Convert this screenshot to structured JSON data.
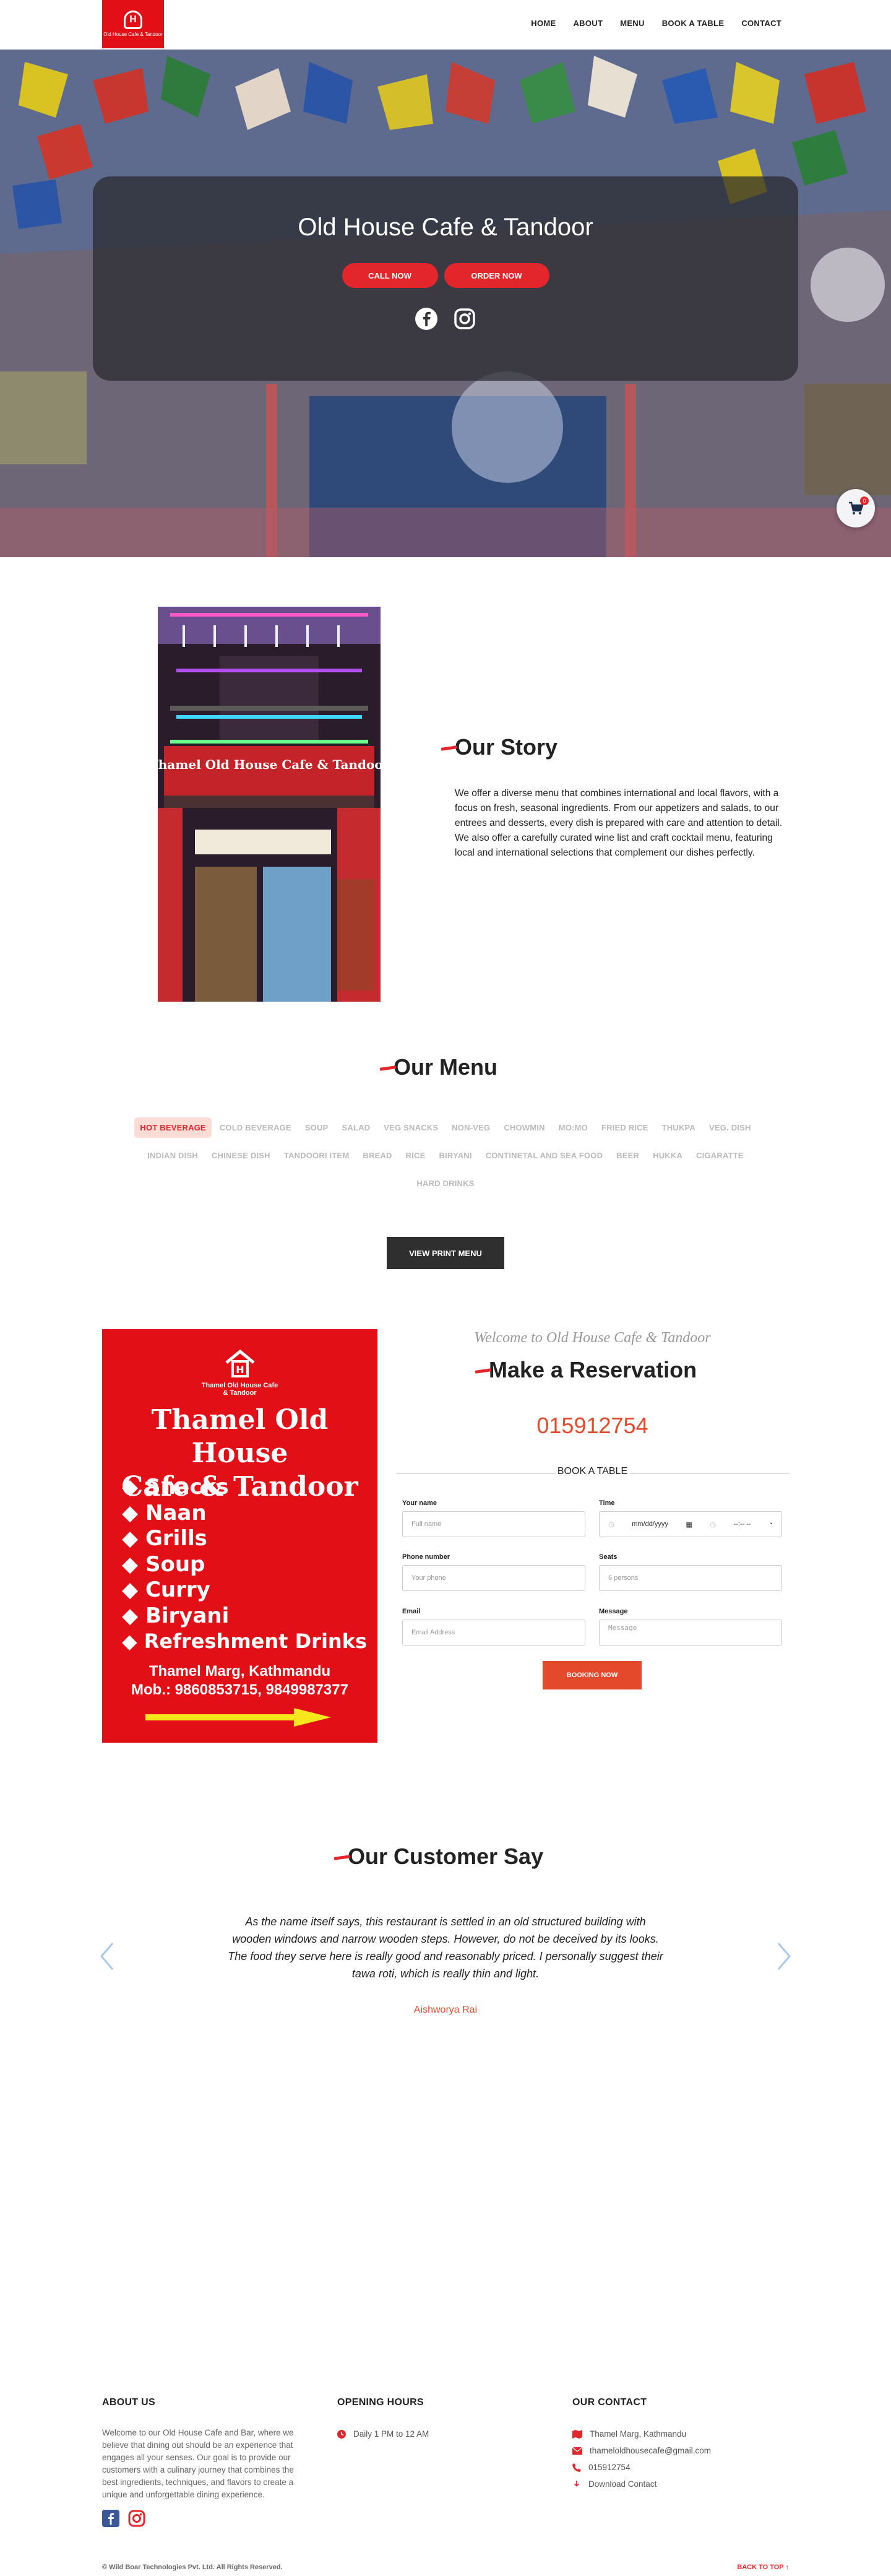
{
  "colors": {
    "brand_red": "#e3262b",
    "accent_orange": "#e5492c",
    "dark": "#2f2f2f"
  },
  "nav": {
    "logo_text": "Old House Cafe & Tandoor",
    "links": [
      "HOME",
      "ABOUT",
      "MENU",
      "BOOK A TABLE",
      "CONTACT"
    ]
  },
  "hero": {
    "title": "Old House Cafe & Tandoor",
    "call_label": "CALL NOW",
    "order_label": "ORDER NOW",
    "social_icons": [
      "facebook-icon",
      "instagram-icon"
    ],
    "cart_count": "0"
  },
  "story": {
    "heading": "Our Story",
    "sign_text": "Thamel Old House Cafe & Tandoor",
    "paragraph": "We offer a diverse menu that combines international and local flavors, with a focus on fresh, seasonal ingredients. From our appetizers and salads, to our entrees and desserts, every dish is prepared with care and attention to detail. We also offer a carefully curated wine list and craft cocktail menu, featuring local and international selections that complement our dishes perfectly."
  },
  "menu": {
    "heading": "Our Menu",
    "categories": [
      "HOT BEVERAGE",
      "COLD BEVERAGE",
      "SOUP",
      "SALAD",
      "VEG SNACKS",
      "NON-VEG",
      "CHOWMIN",
      "MO:MO",
      "FRIED RICE",
      "THUKPA",
      "VEG. DISH",
      "INDIAN DISH",
      "CHINESE DISH",
      "TANDOORI ITEM",
      "BREAD",
      "RICE",
      "BIRYANI",
      "CONTINETAL AND SEA FOOD",
      "BEER",
      "HUKKA",
      "CIGARATTE",
      "HARD DRINKS"
    ],
    "active_index": 0,
    "print_label": "VIEW PRINT MENU"
  },
  "poster": {
    "logo_line1": "Thamel Old House Cafe",
    "logo_line2": "& Tandoor",
    "title_line1": "Thamel Old House",
    "title_line2": "Cafe & Tandoor",
    "items": [
      "Snacks",
      "Naan",
      "Grills",
      "Soup",
      "Curry",
      "Biryani",
      "Refreshment Drinks"
    ],
    "address": "Thamel Marg, Kathmandu",
    "mobile": "Mob.: 9860853715, 9849987377"
  },
  "reservation": {
    "welcome": "Welcome to Old House Cafe & Tandoor",
    "heading": "Make a Reservation",
    "phone": "015912754",
    "book_title": "BOOK A TABLE",
    "fields": {
      "name_label": "Your name",
      "name_placeholder": "Full name",
      "time_label": "Time",
      "date_placeholder": "mm/dd/yyyy",
      "time_placeholder": "--:-- --",
      "phone_label": "Phone number",
      "phone_placeholder": "Your phone",
      "seats_label": "Seats",
      "seats_placeholder": "6 persons",
      "email_label": "Email",
      "email_placeholder": "Email Address",
      "message_label": "Message",
      "message_placeholder": "Message"
    },
    "submit_label": "BOOKING NOW"
  },
  "testimonial": {
    "heading": "Our Customer Say",
    "quote": "As the name itself says, this restaurant is settled in an old structured building with wooden windows and narrow wooden steps. However, do not be deceived by its looks. The food they serve here is really good and reasonably priced. I personally suggest their tawa roti, which is really thin and light.",
    "author": "Aishworya Rai"
  },
  "footer": {
    "about_heading": "ABOUT US",
    "about_text": "Welcome to our Old House Cafe and Bar, where we believe that dining out should be an experience that engages all your senses. Our goal is to provide our customers with a culinary journey that combines the best ingredients, techniques, and flavors to create a unique and unforgettable dining experience.",
    "hours_heading": "OPENING HOURS",
    "hours": "Daily 1 PM to 12 AM",
    "contact_heading": "OUR CONTACT",
    "address": "Thamel Marg, Kathmandu",
    "email": "thameloldhousecafe@gmail.com",
    "phone": "015912754",
    "download": "Download Contact",
    "copyright": "© Wild Boar Technologies Pvt. Ltd. All Rights Reserved.",
    "back_to_top": "BACK TO TOP ↑"
  }
}
